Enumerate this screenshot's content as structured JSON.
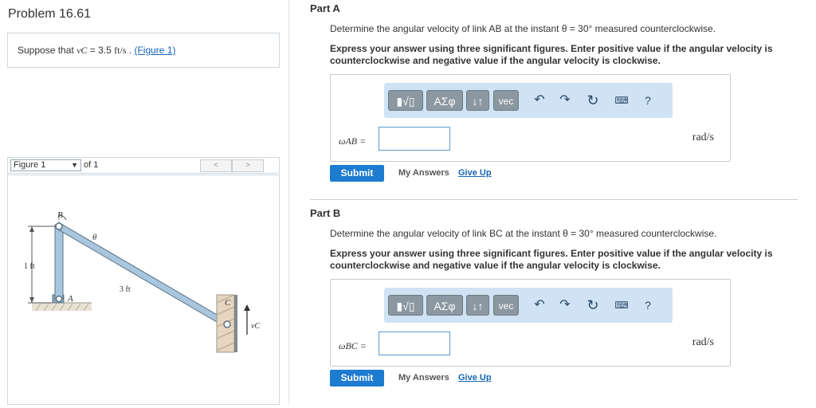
{
  "problem": {
    "title": "Problem 16.61",
    "prompt_prefix": "Suppose that ",
    "prompt_var": "vC",
    "prompt_eq": " = 3.5 ",
    "prompt_unit": "ft/s",
    "prompt_dot": " . ",
    "figure_link": "(Figure 1)"
  },
  "figure_nav": {
    "selected": "Figure 1",
    "of_text": "of 1",
    "prev": "<",
    "next": ">"
  },
  "figure": {
    "label_B": "B",
    "label_A": "A",
    "label_C": "C",
    "label_theta": "θ",
    "label_1ft": "1 ft",
    "label_3ft": "3 ft",
    "label_vc": "vC"
  },
  "toolbar": {
    "matrix_label": "▮√▯",
    "greek_label": "ΑΣφ",
    "sort_label": "↓↑",
    "vec_label": "vec",
    "undo_icon": "undo-arrow",
    "redo_icon": "redo-arrow",
    "reset_icon": "reset-circle",
    "keyboard_icon": "keyboard",
    "help_label": "?"
  },
  "partA": {
    "title": "Part A",
    "question": "Determine the angular velocity of link AB at the instant θ = 30° measured counterclockwise.",
    "instructions": "Express your answer using three significant figures. Enter positive value if the angular velocity is counterclockwise and negative value if the angular velocity is clockwise.",
    "var_label": "ωAB =",
    "input_value": "",
    "unit": "rad/s",
    "submit": "Submit",
    "my_answers": "My Answers",
    "give_up": "Give Up"
  },
  "partB": {
    "title": "Part B",
    "question": "Determine the angular velocity of link BC at the instant θ = 30° measured counterclockwise.",
    "instructions": "Express your answer using three significant figures. Enter positive value if the angular velocity is counterclockwise and negative value if the angular velocity is clockwise.",
    "var_label": "ωBC =",
    "input_value": "",
    "unit": "rad/s",
    "submit": "Submit",
    "my_answers": "My Answers",
    "give_up": "Give Up"
  },
  "colors": {
    "accent": "#1d7bd0",
    "link": "#1565b6",
    "toolbar_bg": "#cfe3f4",
    "tool_button": "#8b98a1",
    "link_bar": "#a9c6df"
  }
}
